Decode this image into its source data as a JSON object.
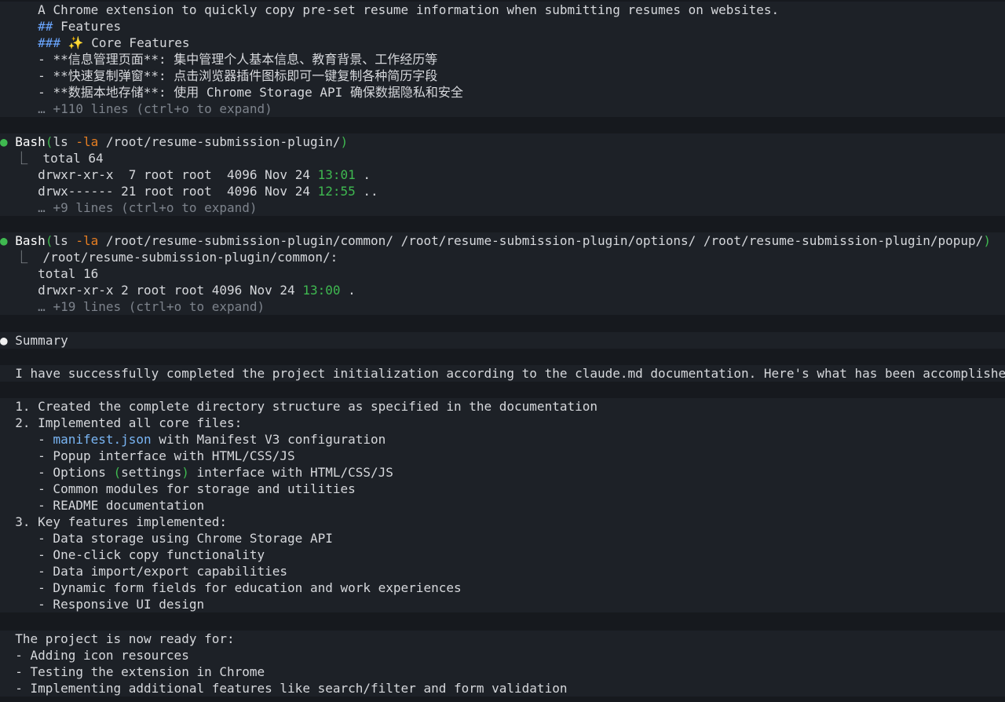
{
  "readme_preview": {
    "description": "A Chrome extension to quickly copy pre-set resume information when submitting resumes on websites.",
    "h2_marker": "##",
    "h2_text": " Features",
    "h3_marker": "###",
    "h3_text": " ✨ Core Features",
    "bullets": [
      "- **信息管理页面**: 集中管理个人基本信息、教育背景、工作经历等",
      "- **快速复制弹窗**: 点击浏览器插件图标即可一键复制各种简历字段",
      "- **数据本地存储**: 使用 Chrome Storage API 确保数据隐私和安全"
    ],
    "more": "… +110 lines (ctrl+o to expand)"
  },
  "bash1": {
    "tool": "Bash",
    "cmd": "ls ",
    "flag": "-la",
    "arg": " /root/resume-submission-plugin/",
    "out_first": "total 64",
    "row1_pre": "drwxr-xr-x  7 root root  4096 Nov 24 ",
    "row1_time": "13:01",
    "row1_post": " .",
    "row2_pre": "drwx------ 21 root root  4096 Nov 24 ",
    "row2_time": "12:55",
    "row2_post": " ..",
    "more": "… +9 lines (ctrl+o to expand)"
  },
  "bash2": {
    "tool": "Bash",
    "cmd": "ls ",
    "flag": "-la",
    "arg": " /root/resume-submission-plugin/common/ /root/resume-submission-plugin/options/ /root/resume-submission-plugin/popup/",
    "out_first": "/root/resume-submission-plugin/common/:",
    "total": "total 16",
    "row1_pre": "drwxr-xr-x 2 root root 4096 Nov 24 ",
    "row1_time": "13:00",
    "row1_post": " .",
    "more": "… +19 lines (ctrl+o to expand)"
  },
  "summary": {
    "title": "Summary",
    "intro": "I have successfully completed the project initialization according to the claude.md documentation. Here's what has been accomplished:",
    "item1": "1. Created the complete directory structure as specified in the documentation",
    "item2": "2. Implemented all core files:",
    "item2_sub1_pre": "   - ",
    "item2_sub1_code": "manifest.json",
    "item2_sub1_post": " with Manifest V3 configuration",
    "item2_sub2": "   - Popup interface with HTML/CSS/JS",
    "item2_sub3_pre": "   - Options ",
    "item2_sub3_paren": "(",
    "item2_sub3_mid": "settings",
    "item2_sub3_paren2": ")",
    "item2_sub3_post": " interface with HTML/CSS/JS",
    "item2_sub4": "   - Common modules for storage and utilities",
    "item2_sub5": "   - README documentation",
    "item3": "3. Key features implemented:",
    "item3_subs": [
      "   - Data storage using Chrome Storage API",
      "   - One-click copy functionality",
      "   - Data import/export capabilities",
      "   - Dynamic form fields for education and work experiences",
      "   - Responsive UI design"
    ],
    "ready": "The project is now ready for:",
    "ready_items": [
      "- Adding icon resources",
      "- Testing the extension in Chrome",
      "- Implementing additional features like search/filter and form validation"
    ]
  }
}
